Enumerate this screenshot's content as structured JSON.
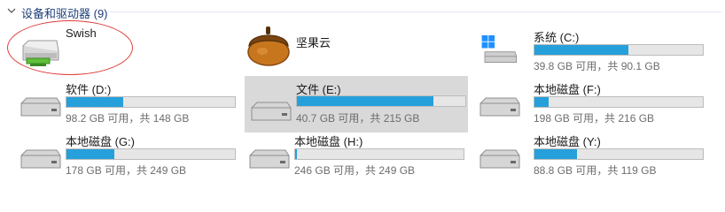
{
  "group": {
    "title": "设备和驱动器 (9)"
  },
  "items": [
    {
      "name": "Swish",
      "icon": "network-drive-icon"
    },
    {
      "name": "坚果云",
      "icon": "nut-app-icon"
    },
    {
      "name": "系统 (C:)",
      "icon": "windows-drive-icon",
      "used_fraction": 0.558,
      "info": "39.8 GB 可用，共 90.1 GB"
    },
    {
      "name": "软件 (D:)",
      "icon": "drive-icon",
      "used_fraction": 0.336,
      "info": "98.2 GB 可用，共 148 GB"
    },
    {
      "name": "文件 (E:)",
      "icon": "drive-icon",
      "used_fraction": 0.81,
      "info": "40.7 GB 可用，共 215 GB",
      "state": "hover"
    },
    {
      "name": "本地磁盘 (F:)",
      "icon": "drive-icon",
      "used_fraction": 0.083,
      "info": "198 GB 可用，共 216 GB"
    },
    {
      "name": "本地磁盘 (G:)",
      "icon": "drive-icon",
      "used_fraction": 0.285,
      "info": "178 GB 可用，共 249 GB"
    },
    {
      "name": "本地磁盘 (H:)",
      "icon": "drive-icon",
      "used_fraction": 0.012,
      "info": "246 GB 可用，共 249 GB"
    },
    {
      "name": "本地磁盘 (Y:)",
      "icon": "drive-icon",
      "used_fraction": 0.254,
      "info": "88.8 GB 可用，共 119 GB"
    }
  ],
  "colors": {
    "bar_fill": "#26a0da",
    "bar_track": "#e6e6e6",
    "hover_bg": "#d9d9d9",
    "annotation": "#e03a3a",
    "header_text": "#1e3d7a"
  }
}
